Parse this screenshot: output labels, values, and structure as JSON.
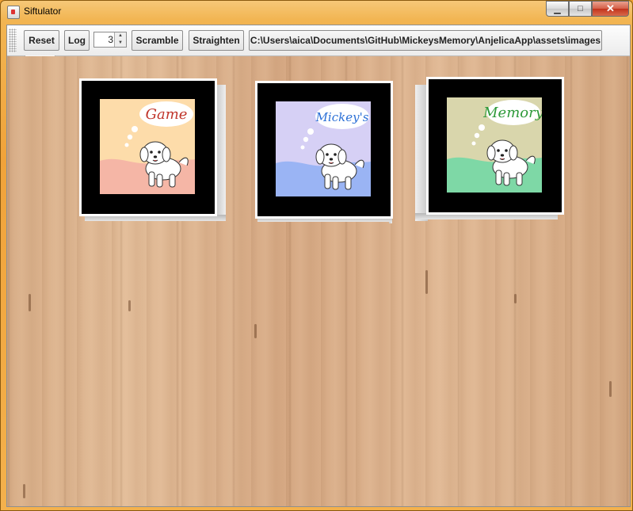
{
  "window": {
    "title": "Siftulator",
    "close_glyph": "✕",
    "min_glyph": "▁",
    "max_glyph": "□"
  },
  "toolbar": {
    "reset_label": "Reset",
    "log_label": "Log",
    "spinner_value": "3",
    "scramble_label": "Scramble",
    "straighten_label": "Straighten",
    "path_label": "C:\\Users\\aica\\Documents\\GitHub\\MickeysMemory\\AnjelicaApp\\assets\\images"
  },
  "cubes": [
    {
      "word": "Game",
      "word_color": "#c0342a",
      "sky": "#fddcaa",
      "ground": "#f5b6a6"
    },
    {
      "word": "Mickey's",
      "word_color": "#2a6fd6",
      "sky": "#d6d0f5",
      "ground": "#9ab4f4"
    },
    {
      "word": "Memory",
      "word_color": "#2e9a3a",
      "sky": "#d9d6ac",
      "ground": "#7ed8a6"
    }
  ],
  "icons": {
    "app": "java-cup-icon",
    "spin_up": "▲",
    "spin_down": "▼"
  }
}
